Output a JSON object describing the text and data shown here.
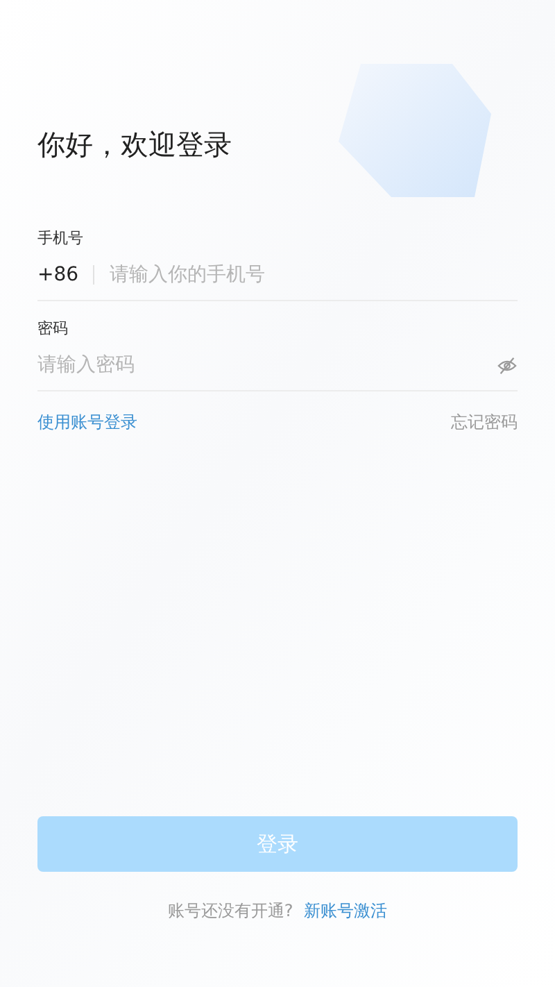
{
  "title": "你好，欢迎登录",
  "phone": {
    "label": "手机号",
    "country_code": "+86",
    "placeholder": "请输入你的手机号"
  },
  "password": {
    "label": "密码",
    "placeholder": "请输入密码",
    "visible": false
  },
  "links": {
    "account_login": "使用账号登录",
    "forgot_password": "忘记密码"
  },
  "login_button": {
    "label": "登录",
    "disabled": true
  },
  "footer": {
    "prompt": "账号还没有开通?",
    "link": "新账号激活"
  }
}
